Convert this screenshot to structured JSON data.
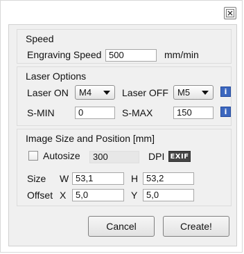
{
  "window": {
    "close_icon": "close-icon"
  },
  "speed": {
    "title": "Speed",
    "engraving_label": "Engraving Speed",
    "engraving_value": "500",
    "unit": "mm/min"
  },
  "laser_options": {
    "title": "Laser Options",
    "laser_on_label": "Laser ON",
    "laser_on_value": "M4",
    "laser_off_label": "Laser OFF",
    "laser_off_value": "M5",
    "smin_label": "S-MIN",
    "smin_value": "0",
    "smax_label": "S-MAX",
    "smax_value": "150",
    "info_text": "i"
  },
  "image_size": {
    "title": "Image Size and Position [mm]",
    "autosize_label": "Autosize",
    "autosize_checked": false,
    "dpi_value": "300",
    "dpi_label": "DPI",
    "exif_label": "EXIF",
    "size_label": "Size",
    "w_label": "W",
    "w_value": "53,1",
    "h_label": "H",
    "h_value": "53,2",
    "offset_label": "Offset",
    "x_label": "X",
    "x_value": "5,0",
    "y_label": "Y",
    "y_value": "5,0"
  },
  "buttons": {
    "cancel": "Cancel",
    "create": "Create!"
  }
}
